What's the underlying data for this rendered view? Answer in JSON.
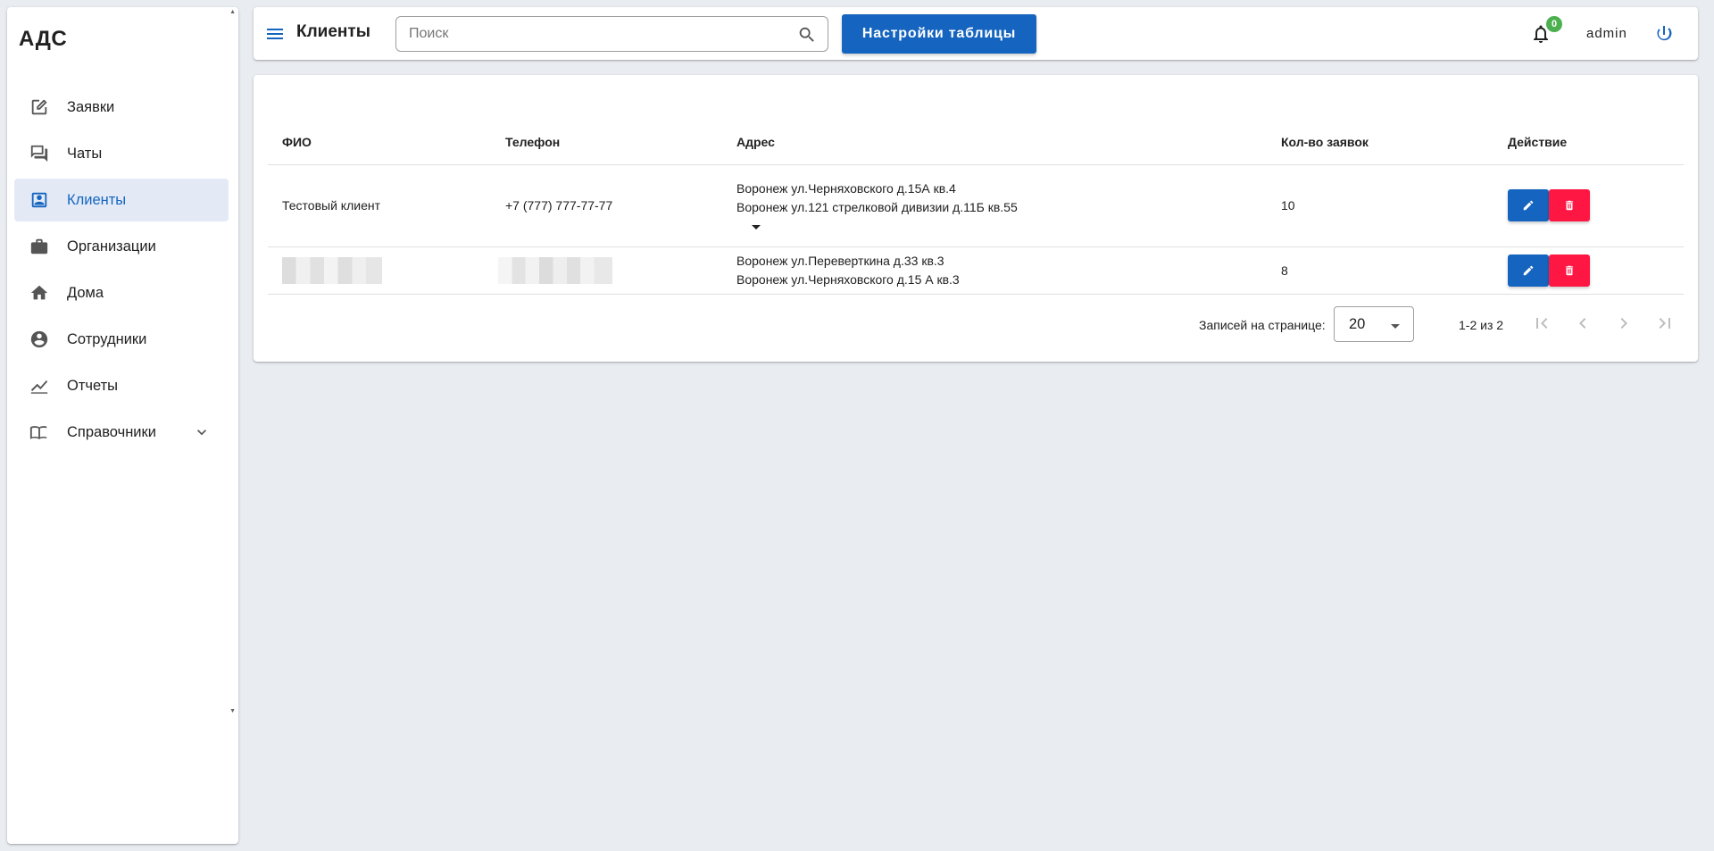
{
  "app": {
    "logo": "АДС"
  },
  "sidebar": {
    "items": [
      {
        "label": "Заявки",
        "icon": "edit-note-icon"
      },
      {
        "label": "Чаты",
        "icon": "chat-icon"
      },
      {
        "label": "Клиенты",
        "icon": "contact-card-icon",
        "active": true
      },
      {
        "label": "Организации",
        "icon": "briefcase-icon"
      },
      {
        "label": "Дома",
        "icon": "home-icon"
      },
      {
        "label": "Сотрудники",
        "icon": "account-circle-icon"
      },
      {
        "label": "Отчеты",
        "icon": "line-chart-icon"
      },
      {
        "label": "Справочники",
        "icon": "book-icon",
        "expandable": true
      }
    ]
  },
  "header": {
    "title": "Клиенты",
    "search_placeholder": "Поиск",
    "settings_label": "Настройки таблицы",
    "notifications_count": "0",
    "username": "admin"
  },
  "table": {
    "columns": [
      "ФИО",
      "Телефон",
      "Адрес",
      "Кол-во заявок",
      "Действие"
    ],
    "rows": [
      {
        "name": "Тестовый клиент",
        "phone": "+7 (777) 777-77-77",
        "addresses": [
          "Воронеж ул.Черняховского д.15А кв.4",
          "Воронеж ул.121 стрелковой дивизии д.11Б кв.55"
        ],
        "count": "10",
        "expandable": true
      },
      {
        "name": "",
        "phone": "",
        "redacted": true,
        "addresses": [
          "Воронеж ул.Переверткина д.33 кв.3",
          "Воронеж ул.Черняховского д.15 А кв.3"
        ],
        "count": "8"
      }
    ]
  },
  "pagination": {
    "rows_per_page_label": "Записей на странице:",
    "rows_per_page": "20",
    "range": "1-2 из 2"
  },
  "colors": {
    "primary": "#1565c0",
    "danger": "#ff1744",
    "badge": "#4caf50",
    "active_bg": "#e3eaf5"
  }
}
